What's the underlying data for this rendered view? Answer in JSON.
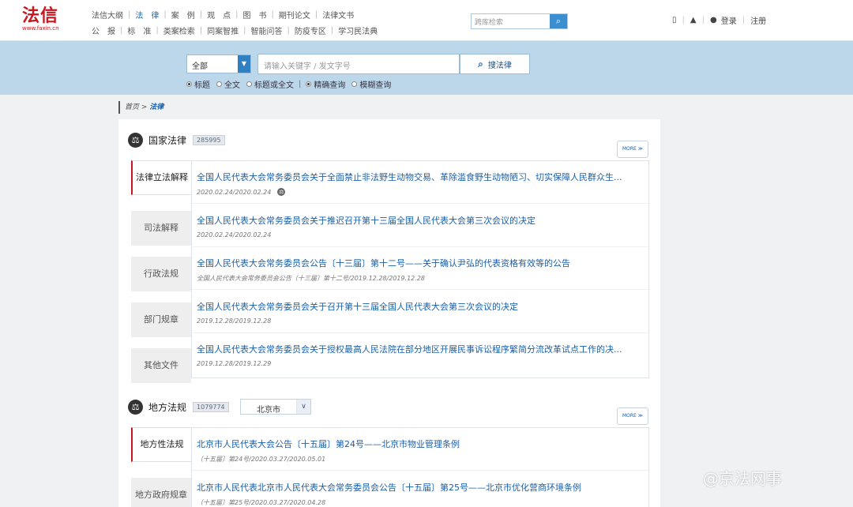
{
  "logo": {
    "main": "法信",
    "sub": "www.faxin.cn"
  },
  "nav": {
    "row1": [
      "法信大纲",
      "法　律",
      "案　例",
      "观　点",
      "图　书",
      "期刊论文",
      "法律文书"
    ],
    "row2": [
      "公　报",
      "标　准",
      "类案检索",
      "同案智推",
      "智能问答",
      "防疫专区",
      "学习民法典"
    ],
    "active": "法　律"
  },
  "top_search": {
    "placeholder": "跨库检索",
    "icon": "search-icon"
  },
  "top_right": {
    "login": "登录",
    "register": "注册",
    "icons": [
      "mobile-icon",
      "alert-icon",
      "user-icon"
    ]
  },
  "search": {
    "scope": "全部",
    "placeholder": "请输入关键字 / 发文字号",
    "button": "搜法律",
    "options": [
      {
        "label": "标题",
        "checked": true
      },
      {
        "label": "全文",
        "checked": false
      },
      {
        "label": "标题或全文",
        "checked": false
      },
      {
        "label": "精确查询",
        "checked": true
      },
      {
        "label": "模糊查询",
        "checked": false
      }
    ]
  },
  "breadcrumb": {
    "home": "首页",
    "sep": " > ",
    "current": "法律"
  },
  "national": {
    "title": "国家法律",
    "count": "285995",
    "more": "MORE ≫",
    "tabs": [
      "法律立法解释",
      "司法解释",
      "行政法规",
      "部门规章",
      "其他文件"
    ],
    "items": [
      {
        "title": "全国人民代表大会常务委员会关于全面禁止非法野生动物交易、革除滥食野生动物陋习、切实保障人民群众生...",
        "meta": "2020.02.24/2020.02.24"
      },
      {
        "title": "全国人民代表大会常务委员会关于推迟召开第十三届全国人民代表大会第三次会议的决定",
        "meta": "2020.02.24/2020.02.24"
      },
      {
        "title": "全国人民代表大会常务委员会公告〔十三届〕第十二号——关于确认尹弘的代表资格有效等的公告",
        "meta": "全国人民代表大会常务委员会公告〔十三届〕第十二号/2019.12.28/2019.12.28"
      },
      {
        "title": "全国人民代表大会常务委员会关于召开第十三届全国人民代表大会第三次会议的决定",
        "meta": "2019.12.28/2019.12.28"
      },
      {
        "title": "全国人民代表大会常务委员会关于授权最高人民法院在部分地区开展民事诉讼程序繁简分流改革试点工作的决...",
        "meta": "2019.12.28/2019.12.29"
      }
    ]
  },
  "local": {
    "title": "地方法规",
    "count": "1079774",
    "city": "北京市",
    "more": "MORE ≫",
    "tabs": [
      "地方性法规",
      "地方政府规章"
    ],
    "items": [
      {
        "title": "北京市人民代表大会公告〔十五届〕第24号——北京市物业管理条例",
        "meta": "〔十五届〕第24号/2020.03.27/2020.05.01"
      },
      {
        "title": "北京市人民代表北京市人民代表大会常务委员会公告〔十五届〕第25号——北京市优化营商环境条例",
        "meta": "〔十五届〕第25号/2020.03.27/2020.04.28"
      }
    ]
  },
  "watermark": "@京法网事"
}
